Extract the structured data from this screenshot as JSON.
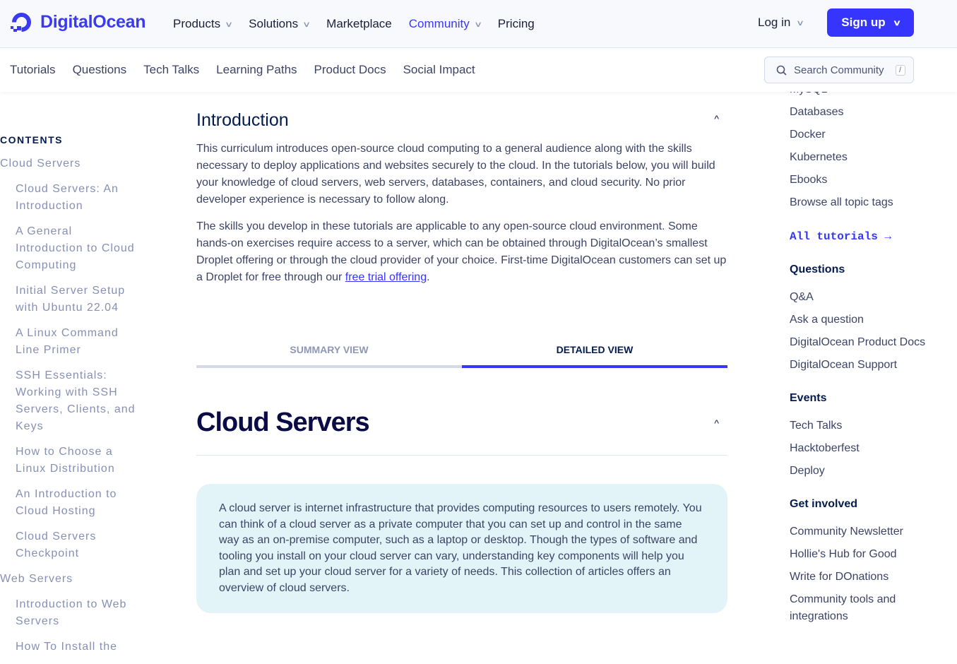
{
  "header": {
    "brand": "DigitalOcean",
    "nav": [
      {
        "label": "Products",
        "dropdown": true
      },
      {
        "label": "Solutions",
        "dropdown": true
      },
      {
        "label": "Marketplace",
        "dropdown": false
      },
      {
        "label": "Community",
        "dropdown": true,
        "active": true
      },
      {
        "label": "Pricing",
        "dropdown": false
      }
    ],
    "login": "Log in",
    "signup": "Sign up"
  },
  "subnav": {
    "items": [
      "Tutorials",
      "Questions",
      "Tech Talks",
      "Learning Paths",
      "Product Docs",
      "Social Impact"
    ],
    "search_placeholder": "Search Community",
    "search_shortcut": "/"
  },
  "toc": {
    "heading": "CONTENTS",
    "items": [
      {
        "label": "Cloud Servers",
        "level": 1
      },
      {
        "label": "Cloud Servers: An Introduction",
        "level": 2
      },
      {
        "label": "A General Introduction to Cloud Computing",
        "level": 2
      },
      {
        "label": "Initial Server Setup with Ubuntu 22.04",
        "level": 2
      },
      {
        "label": "A Linux Command Line Primer",
        "level": 2
      },
      {
        "label": "SSH Essentials: Working with SSH Servers, Clients, and Keys",
        "level": 2
      },
      {
        "label": "How to Choose a Linux Distribution",
        "level": 2
      },
      {
        "label": "An Introduction to Cloud Hosting",
        "level": 2
      },
      {
        "label": "Cloud Servers Checkpoint",
        "level": 2
      },
      {
        "label": "Web Servers",
        "level": 1
      },
      {
        "label": "Introduction to Web Servers",
        "level": 2
      },
      {
        "label": "How To Install the",
        "level": 2
      }
    ]
  },
  "main": {
    "intro_title": "Introduction",
    "p1": "This curriculum introduces open-source cloud computing to a general audience along with the skills necessary to deploy applications and websites securely to the cloud. In the tutorials below, you will build your knowledge of cloud servers, web servers, databases, containers, and cloud security. No prior developer experience is necessary to follow along.",
    "p2": "The skills you develop in these tutorials are applicable to any open-source cloud environment. Some hands-on exercises require access to a server, which can be obtained through DigitalOcean’s smallest Droplet offering or through the cloud provider of your choice. First-time DigitalOcean customers can set up a Droplet for free through our ",
    "p2_link": "free trial offering",
    "p2_end": ".",
    "tabs": [
      "SUMMARY VIEW",
      "DETAILED VIEW"
    ],
    "section_title": "Cloud Servers",
    "callout": "A cloud server is internet infrastructure that provides computing resources to users remotely. You can think of a cloud server as a private computer that you can set up and control in the same way as an on-premise computer, such as a laptop or desktop. Though the types of software and tooling you install on your cloud server can vary, understanding key components will help you plan and set up your cloud server for a variety of needs. This collection of articles offers an overview of cloud servers."
  },
  "right": {
    "tags": [
      "MySQL",
      "Databases",
      "Docker",
      "Kubernetes",
      "Ebooks",
      "Browse all topic tags"
    ],
    "all_tutorials": "All tutorials →",
    "sections": [
      {
        "title": "Questions",
        "links": [
          "Q&A",
          "Ask a question",
          "DigitalOcean Product Docs",
          "DigitalOcean Support"
        ]
      },
      {
        "title": "Events",
        "links": [
          "Tech Talks",
          "Hacktoberfest",
          "Deploy"
        ]
      },
      {
        "title": "Get involved",
        "links": [
          "Community Newsletter",
          "Hollie's Hub for Good",
          "Write for DOnations",
          "Community tools and integrations"
        ]
      }
    ]
  }
}
